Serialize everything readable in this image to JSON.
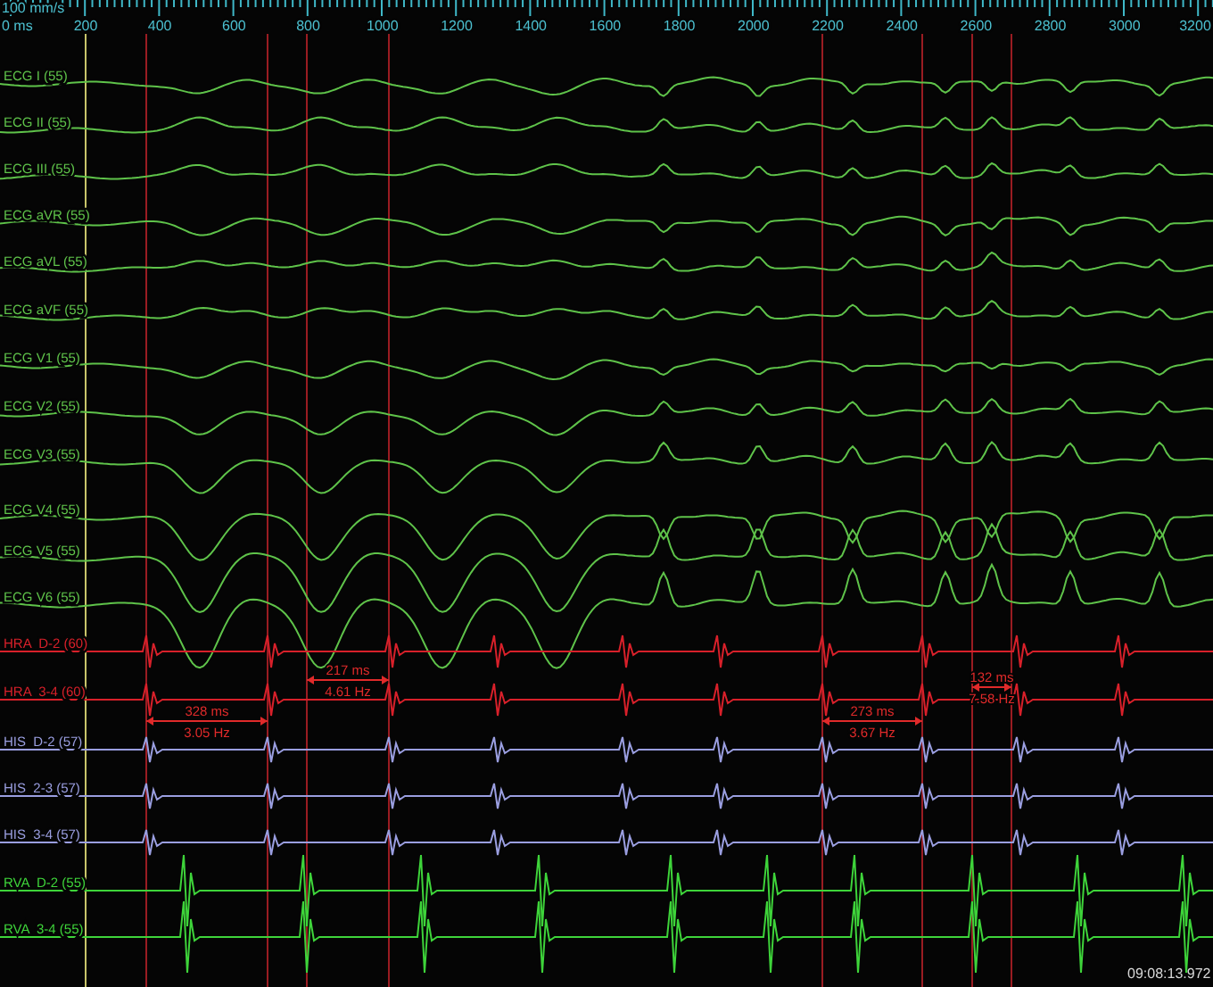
{
  "ruler": {
    "speed": "100 mm/s",
    "origin": "0 ms",
    "labels": [
      "200",
      "400",
      "600",
      "800",
      "1000",
      "1200",
      "1400",
      "1600",
      "1800",
      "2000",
      "2200",
      "2400",
      "2600",
      "2800",
      "3000",
      "3200"
    ]
  },
  "channels": [
    {
      "label": "ECG I (55)",
      "kind": "surface",
      "color": "#5fc34a"
    },
    {
      "label": "ECG II (55)",
      "kind": "surface",
      "color": "#5fc34a"
    },
    {
      "label": "ECG III (55)",
      "kind": "surface",
      "color": "#5fc34a"
    },
    {
      "label": "ECG aVR (55)",
      "kind": "surface",
      "color": "#5fc34a"
    },
    {
      "label": "ECG aVL (55)",
      "kind": "surface",
      "color": "#5fc34a"
    },
    {
      "label": "ECG aVF (55)",
      "kind": "surface",
      "color": "#5fc34a"
    },
    {
      "label": "ECG V1 (55)",
      "kind": "surface",
      "color": "#5fc34a"
    },
    {
      "label": "ECG V2 (55)",
      "kind": "surface",
      "color": "#5fc34a"
    },
    {
      "label": "ECG V3 (55)",
      "kind": "surface",
      "color": "#5fc34a"
    },
    {
      "label": "ECG V4 (55)",
      "kind": "surface",
      "color": "#5fc34a"
    },
    {
      "label": "ECG V5 (55)",
      "kind": "surface",
      "color": "#5fc34a"
    },
    {
      "label": "ECG V6 (55)",
      "kind": "surface",
      "color": "#5fc34a"
    },
    {
      "label": "HRA  D-2 (60)",
      "kind": "atrial",
      "color": "#d8202a"
    },
    {
      "label": "HRA  3-4 (60)",
      "kind": "atrial",
      "color": "#d8202a"
    },
    {
      "label": "HIS  D-2 (57)",
      "kind": "his",
      "color": "#9a9ee0"
    },
    {
      "label": "HIS  2-3 (57)",
      "kind": "his",
      "color": "#9a9ee0"
    },
    {
      "label": "HIS  3-4 (57)",
      "kind": "his",
      "color": "#9a9ee0"
    },
    {
      "label": "RVA  D-2 (55)",
      "kind": "ventricular",
      "color": "#3ed43a"
    },
    {
      "label": "RVA  3-4 (55)",
      "kind": "ventricular",
      "color": "#3ed43a"
    }
  ],
  "measurements": [
    {
      "interval": "217 ms",
      "rate": "4.61 Hz"
    },
    {
      "interval": "328 ms",
      "rate": "3.05 Hz"
    },
    {
      "interval": "273 ms",
      "rate": "3.67 Hz"
    },
    {
      "interval": "132 ms",
      "rate": "7.58 Hz"
    }
  ],
  "timestamp": "09:08:13.972"
}
